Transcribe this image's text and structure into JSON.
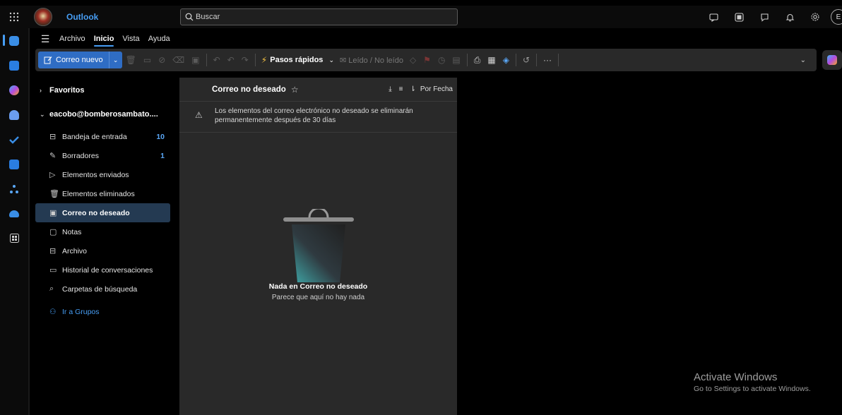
{
  "titlebar": {
    "app_name": "Outlook",
    "search_placeholder": "Buscar",
    "avatar_initial": "E"
  },
  "menubar": {
    "items": [
      "Archivo",
      "Inicio",
      "Vista",
      "Ayuda"
    ],
    "active": "Inicio"
  },
  "ribbon": {
    "new_mail_label": "Correo nuevo",
    "quick_steps_label": "Pasos rápidos",
    "read_unread_label": "Leído / No leído",
    "more_label": "···"
  },
  "folders": {
    "favorites_label": "Favoritos",
    "account_label": "eacobo@bomberosambato....",
    "items": [
      {
        "label": "Bandeja de entrada",
        "count": "10",
        "icon": "inbox-icon"
      },
      {
        "label": "Borradores",
        "count": "1",
        "icon": "pencil-icon"
      },
      {
        "label": "Elementos enviados",
        "count": "",
        "icon": "send-icon"
      },
      {
        "label": "Elementos eliminados",
        "count": "",
        "icon": "trash-icon"
      },
      {
        "label": "Correo no deseado",
        "count": "",
        "icon": "junk-icon"
      },
      {
        "label": "Notas",
        "count": "",
        "icon": "note-icon"
      },
      {
        "label": "Archivo",
        "count": "",
        "icon": "archive-icon"
      },
      {
        "label": "Historial de conversaciones",
        "count": "",
        "icon": "folder-icon"
      },
      {
        "label": "Carpetas de búsqueda",
        "count": "",
        "icon": "search-folder-icon"
      }
    ],
    "selected_index": 4,
    "groups_label": "Ir a Grupos"
  },
  "message_list": {
    "title": "Correo no deseado",
    "sort_label": "Por Fecha",
    "notice_text": "Los elementos del correo electrónico no deseado se eliminarán permanentemente después de 30 días",
    "empty_title": "Nada en Correo no deseado",
    "empty_subtitle": "Parece que aquí no hay nada"
  },
  "watermark": {
    "line1": "Activate Windows",
    "line2": "Go to Settings to activate Windows."
  },
  "colors": {
    "accent": "#479ef5",
    "new_mail_bg": "#2f6dc4",
    "selected_folder_bg": "#243a52",
    "list_bg": "#292929"
  }
}
